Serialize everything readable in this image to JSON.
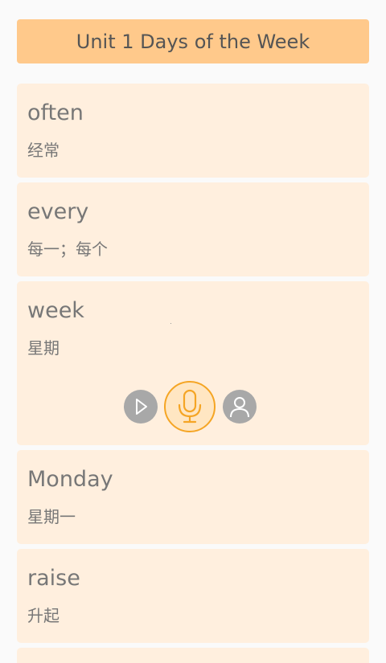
{
  "header": {
    "title": "Unit 1 Days of the Week"
  },
  "words": [
    {
      "word": "often",
      "meaning": "经常"
    },
    {
      "word": "every",
      "meaning": "每一；每个"
    },
    {
      "word": "week",
      "meaning": "星期"
    },
    {
      "word": "Monday",
      "meaning": "星期一"
    },
    {
      "word": "raise",
      "meaning": "升起"
    }
  ],
  "controls": {
    "play_icon": "play-icon",
    "record_icon": "microphone-icon",
    "user_icon": "user-icon"
  },
  "colors": {
    "header_bg": "#ffc98b",
    "card_bg": "#ffefde",
    "accent": "#f5a524",
    "gray_button": "#a8a8a8"
  }
}
